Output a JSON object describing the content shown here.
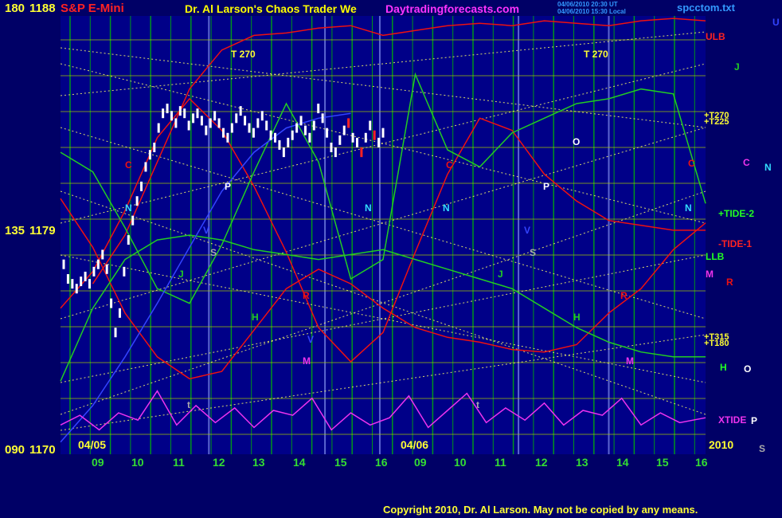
{
  "header": {
    "symbol": "S&P E-Mini",
    "title": "Dr. Al Larson's Chaos Trader We",
    "website": "Daytradingforecasts.com",
    "stamp_ut": "04/06/2010 20:30 UT",
    "stamp_local": "04/06/2010 15:30 Local",
    "file": "spcctom.txt"
  },
  "axis_left": {
    "top_angle": "180",
    "top_price": "1188",
    "mid_angle": "135",
    "mid_price": "1179",
    "bot_angle": "090",
    "bot_price": "1170"
  },
  "dates": {
    "day1": "04/05",
    "day2": "04/06",
    "year": "2010"
  },
  "x_ticks": [
    "09",
    "10",
    "11",
    "12",
    "13",
    "14",
    "15",
    "16",
    "09",
    "10",
    "11",
    "12",
    "13",
    "14",
    "15",
    "16"
  ],
  "right_labels": {
    "ulb": "ULB",
    "u": "U",
    "j": "J",
    "t270_upper": "+T270",
    "t225_upper": "+T225",
    "c": "C",
    "n": "N",
    "tide2": "+TIDE-2",
    "tide1": "-TIDE-1",
    "llb": "LLB",
    "m": "M",
    "r": "R",
    "t315": "+T315",
    "t180": "+T180",
    "h": "H",
    "o": "O",
    "xtide": "XTIDE",
    "p": "P",
    "s": "S"
  },
  "chart_labels": {
    "t270": "T  270",
    "c": "C",
    "n": "N",
    "p": "P",
    "v": "V",
    "s": "S",
    "j": "J",
    "h": "H",
    "m": "M",
    "r": "R",
    "o": "O",
    "t": "t"
  },
  "copyright": "Copyright 2010, Dr. Al Larson. May not be copied by any means.",
  "colors": {
    "background": "#000066",
    "plot_bg": "#000088",
    "grid_v": "#00bb00",
    "grid_h": "#aacc00",
    "yellow_dotted": "#ffff66",
    "red_line": "#ee1111",
    "green_line": "#22cc22",
    "blue_line": "#3344ff",
    "magenta_line": "#ee33ee",
    "white_bars": "#ffffff",
    "red_bars": "#ff2222"
  },
  "chart_data": {
    "type": "line",
    "title": "S&P E-Mini",
    "ylim": [
      1170,
      1188
    ],
    "y_ticks": [
      1170,
      1179,
      1188
    ],
    "x_ticks": [
      "09",
      "10",
      "11",
      "12",
      "13",
      "14",
      "15",
      "16",
      "09",
      "10",
      "11",
      "12",
      "13",
      "14",
      "15",
      "16"
    ],
    "price_bars_day1": [
      1177.8,
      1177.2,
      1177.0,
      1176.8,
      1177.1,
      1177.3,
      1177.0,
      1177.5,
      1177.8,
      1178.2,
      1177.6,
      1176.2,
      1175.0,
      1175.8,
      1177.5,
      1178.8,
      1179.6,
      1180.4,
      1181.0,
      1181.8,
      1182.3,
      1182.6,
      1183.4,
      1184.0,
      1184.2,
      1183.9,
      1183.6,
      1184.1,
      1184.0,
      1183.5,
      1183.8,
      1184.0,
      1183.7,
      1183.3,
      1183.6,
      1183.9,
      1183.6,
      1183.2,
      1183.0,
      1183.4,
      1183.8,
      1184.1,
      1183.7,
      1183.4,
      1183.2,
      1183.6,
      1183.9,
      1183.5,
      1183.1,
      1183.0,
      1182.7,
      1182.4,
      1182.8,
      1183.1,
      1183.4,
      1183.7,
      1183.3,
      1183.0,
      1183.5,
      1184.2,
      1183.8,
      1183.2,
      1182.6,
      1182.4,
      1182.9,
      1183.3,
      1183.6,
      1183.0,
      1182.8,
      1182.4,
      1183.0,
      1183.5,
      1183.1,
      1182.8,
      1183.2
    ],
    "series": [
      {
        "name": "ULB",
        "color": "#ee1111",
        "x": [
          0.05,
          0.1,
          0.15,
          0.2,
          0.25,
          0.3,
          0.35,
          0.4,
          0.45,
          0.5,
          0.55,
          0.6,
          0.65,
          0.7,
          0.75,
          0.8,
          0.85,
          0.9,
          0.95,
          1.0
        ],
        "values": [
          1177,
          1179,
          1182,
          1185,
          1186.6,
          1187.2,
          1187.3,
          1187.5,
          1187.6,
          1187.2,
          1187.4,
          1187.6,
          1187.7,
          1187.6,
          1187.8,
          1187.7,
          1187.6,
          1187.8,
          1187.9,
          1187.8
        ]
      },
      {
        "name": "",
        "color": "#ee1111",
        "x": [
          0.0,
          0.05,
          0.1,
          0.15,
          0.2,
          0.25,
          0.3,
          0.35,
          0.4,
          0.45,
          0.5,
          0.55,
          0.6,
          0.65,
          0.7,
          0.75,
          0.8,
          0.85,
          0.9,
          0.95,
          1.0
        ],
        "values": [
          1176,
          1177.5,
          1180,
          1183,
          1184.6,
          1183.3,
          1181,
          1178.3,
          1175.2,
          1173.8,
          1175,
          1178.3,
          1181.5,
          1183.8,
          1183.3,
          1181.5,
          1180.4,
          1179.6,
          1179.4,
          1179.2,
          1179.2
        ]
      },
      {
        "name": "",
        "color": "#ee1111",
        "x": [
          0.0,
          0.05,
          0.1,
          0.15,
          0.2,
          0.25,
          0.3,
          0.35,
          0.4,
          0.45,
          0.5,
          0.55,
          0.6,
          0.65,
          0.7,
          0.75,
          0.8,
          0.85,
          0.9,
          0.95,
          1.0
        ],
        "values": [
          1180.5,
          1178.5,
          1175.8,
          1174.0,
          1173.1,
          1173.4,
          1175.1,
          1176.8,
          1177.6,
          1177.0,
          1176.0,
          1175.2,
          1174.8,
          1174.6,
          1174.3,
          1174.2,
          1174.5,
          1175.8,
          1176.8,
          1178.4,
          1179.5
        ]
      },
      {
        "name": "",
        "color": "#22cc22",
        "x": [
          0.0,
          0.05,
          0.1,
          0.15,
          0.2,
          0.25,
          0.3,
          0.35,
          0.4,
          0.45,
          0.5,
          0.55,
          0.6,
          0.65,
          0.7,
          0.75,
          0.8,
          0.85,
          0.9,
          0.95,
          1.0
        ],
        "values": [
          1182.4,
          1181.6,
          1179.3,
          1176.8,
          1176.2,
          1178.6,
          1181.6,
          1184.4,
          1182.0,
          1177.2,
          1178.0,
          1185.6,
          1182.5,
          1181.8,
          1183.2,
          1183.8,
          1184.4,
          1184.6,
          1185.0,
          1184.8,
          1180.3
        ]
      },
      {
        "name": "",
        "color": "#22cc22",
        "x": [
          0.0,
          0.05,
          0.1,
          0.15,
          0.2,
          0.25,
          0.3,
          0.35,
          0.4,
          0.45,
          0.5,
          0.55,
          0.6,
          0.65,
          0.7,
          0.75,
          0.8,
          0.85,
          0.9,
          0.95,
          1.0
        ],
        "values": [
          1173,
          1176,
          1178,
          1178.8,
          1179,
          1178.8,
          1178.4,
          1178.2,
          1178.0,
          1178.2,
          1178.4,
          1178.0,
          1177.6,
          1177.2,
          1176.8,
          1176.0,
          1175.2,
          1174.6,
          1174.2,
          1174.0,
          1174.0
        ]
      },
      {
        "name": "",
        "color": "#3344ff",
        "x": [
          0.0,
          0.05,
          0.1,
          0.15,
          0.2,
          0.25,
          0.3,
          0.35,
          0.4,
          0.45
        ],
        "values": [
          1170.5,
          1172.0,
          1174.0,
          1176.2,
          1178.5,
          1180.8,
          1182.4,
          1183.4,
          1183.8,
          1184.0
        ]
      },
      {
        "name": "XTIDE",
        "color": "#ee33ee",
        "x": [
          0.0,
          0.03,
          0.06,
          0.09,
          0.12,
          0.15,
          0.18,
          0.21,
          0.24,
          0.27,
          0.3,
          0.33,
          0.36,
          0.39,
          0.42,
          0.45,
          0.48,
          0.51,
          0.54,
          0.57,
          0.6,
          0.63,
          0.66,
          0.69,
          0.72,
          0.75,
          0.78,
          0.81,
          0.84,
          0.87,
          0.9,
          0.93,
          0.96,
          1.0
        ],
        "values": [
          1171.2,
          1171.6,
          1171.0,
          1171.7,
          1171.4,
          1172.6,
          1171.2,
          1172.0,
          1171.3,
          1171.9,
          1171.1,
          1171.8,
          1171.6,
          1172.3,
          1171.0,
          1171.7,
          1171.2,
          1171.5,
          1172.4,
          1171.1,
          1171.8,
          1172.5,
          1171.3,
          1171.9,
          1171.4,
          1172.1,
          1171.2,
          1171.8,
          1171.6,
          1172.3,
          1171.2,
          1171.7,
          1171.3,
          1171.5
        ]
      }
    ]
  }
}
